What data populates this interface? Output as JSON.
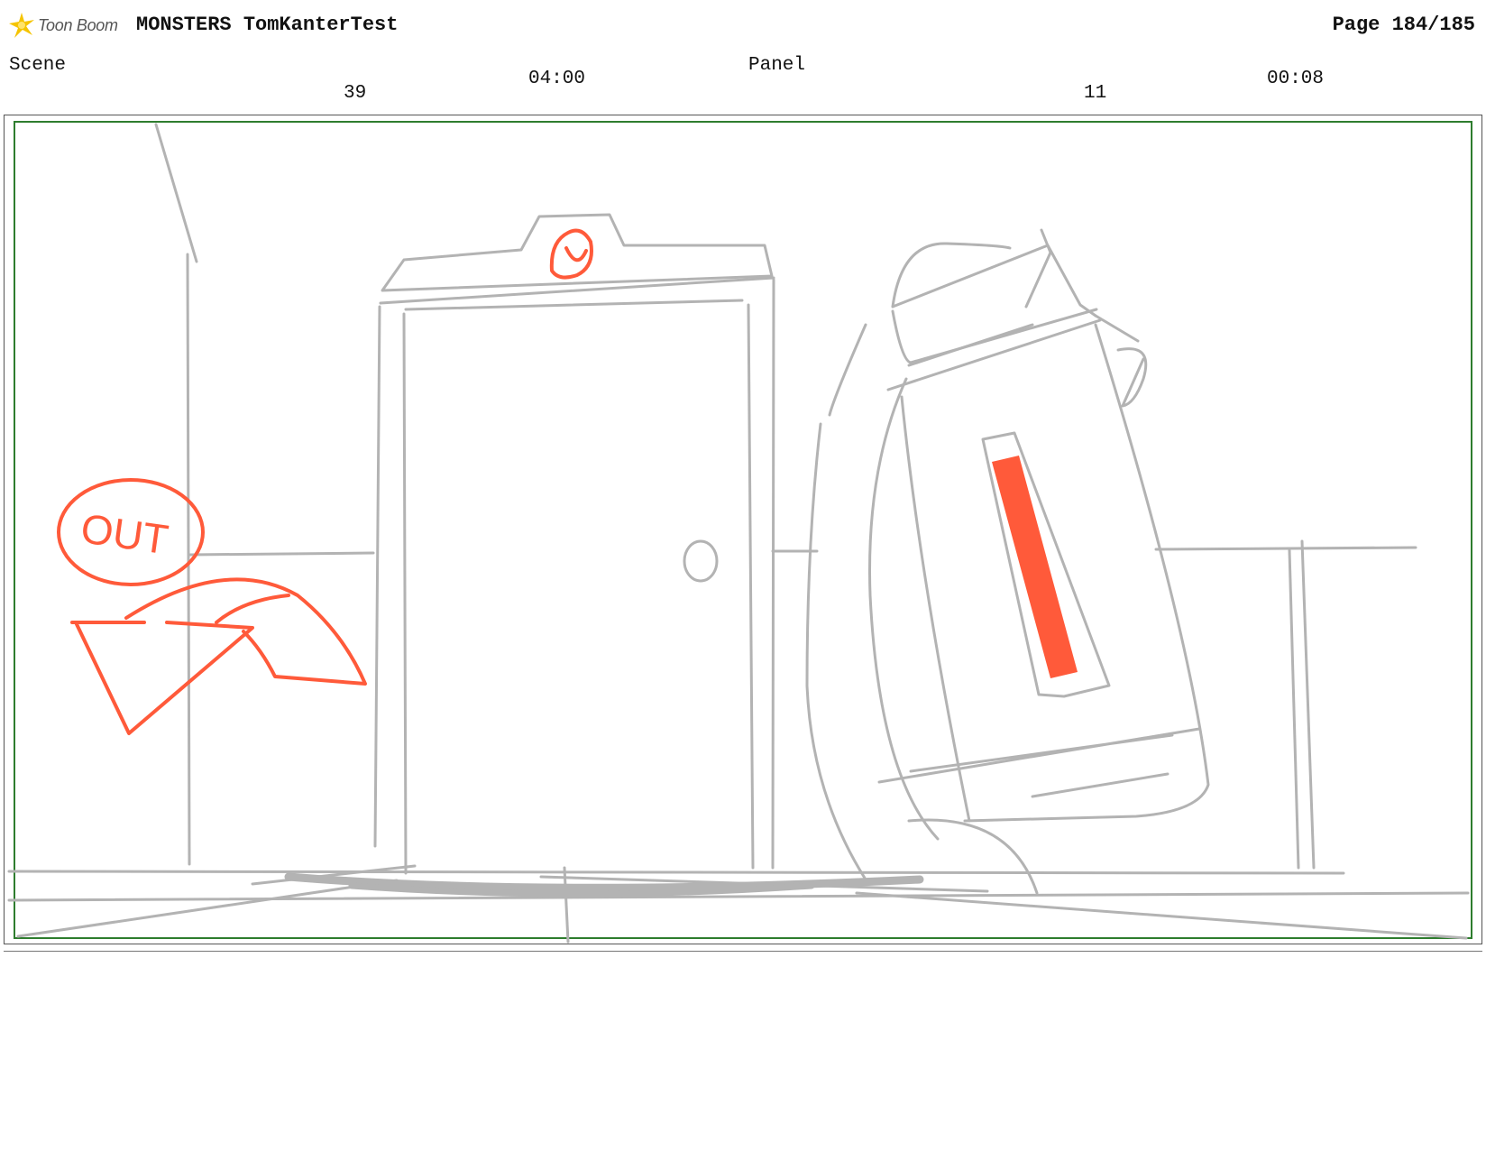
{
  "header": {
    "logo_text": "Toon Boom",
    "title": "MONSTERS TomKanterTest",
    "page": "Page 184/185"
  },
  "meta": {
    "scene_label": "Scene",
    "scene_number": "39",
    "scene_duration": "04:00",
    "panel_label": "Panel",
    "panel_number": "11",
    "panel_duration": "00:08"
  },
  "sketch": {
    "annotation_text": "OUT",
    "colors": {
      "pencil": "#b3b3b3",
      "annotation": "#ff5a3a",
      "safe_frame": "#2e7d2e",
      "logo_star": "#f5c400"
    }
  }
}
